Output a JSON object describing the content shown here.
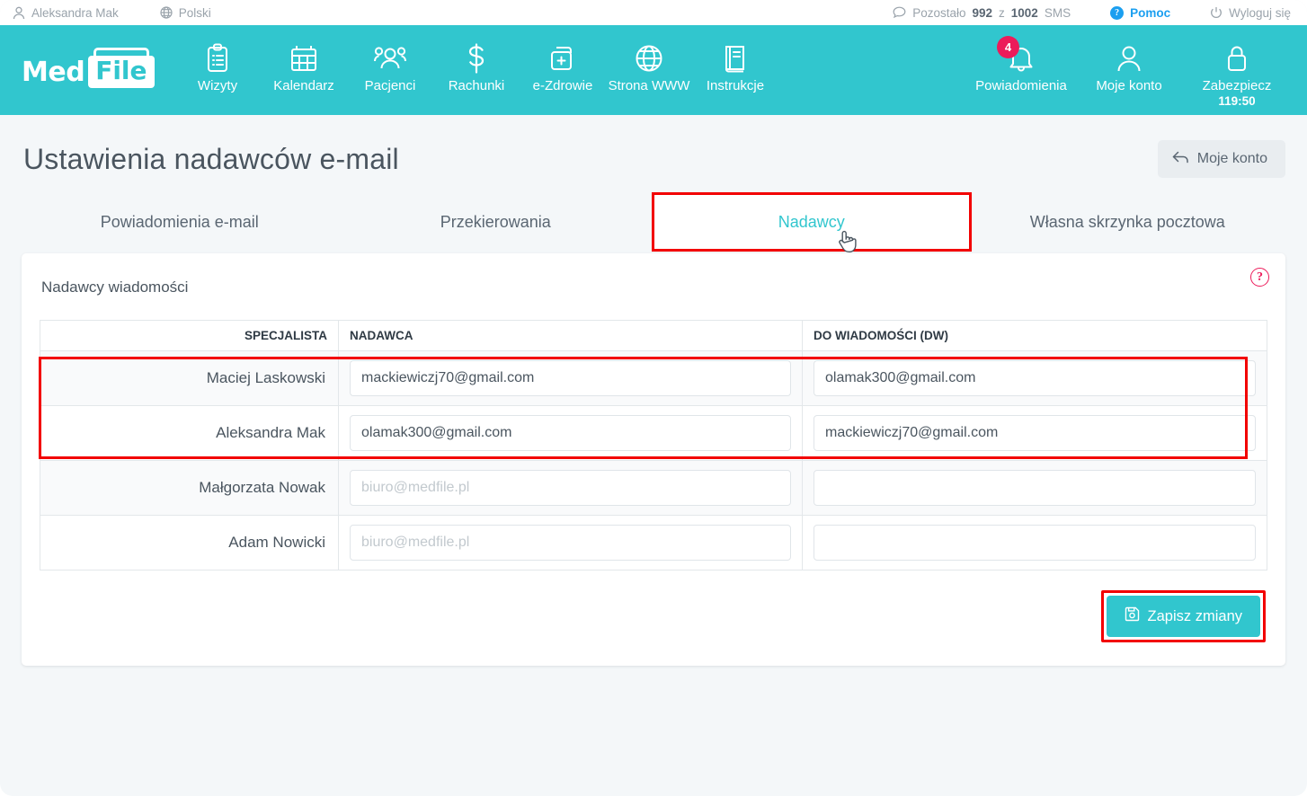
{
  "topbar": {
    "user": "Aleksandra Mak",
    "language": "Polski",
    "sms": {
      "prefix": "Pozostało",
      "remaining": "992",
      "middle": "z",
      "total": "1002",
      "suffix": "SMS"
    },
    "help": "Pomoc",
    "help_badge": "?",
    "logout": "Wyloguj się"
  },
  "brand": {
    "part1": "Med",
    "part2": "File"
  },
  "nav": {
    "items": [
      {
        "label": "Wizyty",
        "icon": "clipboard-icon"
      },
      {
        "label": "Kalendarz",
        "icon": "calendar-icon"
      },
      {
        "label": "Pacjenci",
        "icon": "people-icon"
      },
      {
        "label": "Rachunki",
        "icon": "dollar-icon"
      },
      {
        "label": "e-Zdrowie",
        "icon": "medical-file-icon"
      },
      {
        "label": "Strona WWW",
        "icon": "globe-icon"
      },
      {
        "label": "Instrukcje",
        "icon": "book-icon"
      }
    ],
    "right": [
      {
        "label": "Powiadomienia",
        "icon": "bell-icon",
        "badge": "4"
      },
      {
        "label": "Moje konto",
        "icon": "user-icon"
      },
      {
        "label": "Zabezpiecz",
        "icon": "lock-icon",
        "timer": "119:50"
      }
    ]
  },
  "page": {
    "title": "Ustawienia nadawców e-mail",
    "back_button": "Moje konto"
  },
  "tabs": [
    {
      "label": "Powiadomienia e-mail",
      "active": false
    },
    {
      "label": "Przekierowania",
      "active": false
    },
    {
      "label": "Nadawcy",
      "active": true
    },
    {
      "label": "Własna skrzynka pocztowa",
      "active": false
    }
  ],
  "card": {
    "title": "Nadawcy wiadomości",
    "help_icon": "?"
  },
  "table": {
    "headers": {
      "specialist": "SPECJALISTA",
      "sender": "NADAWCA",
      "cc": "DO WIADOMOŚCI (DW)"
    },
    "placeholder": "biuro@medfile.pl",
    "rows": [
      {
        "name": "Maciej Laskowski",
        "sender": "mackiewiczj70@gmail.com",
        "cc": "olamak300@gmail.com"
      },
      {
        "name": "Aleksandra Mak",
        "sender": "olamak300@gmail.com",
        "cc": "mackiewiczj70@gmail.com"
      },
      {
        "name": "Małgorzata Nowak",
        "sender": "",
        "cc": ""
      },
      {
        "name": "Adam Nowicki",
        "sender": "",
        "cc": ""
      }
    ]
  },
  "actions": {
    "save": "Zapisz zmiany"
  },
  "colors": {
    "accent_teal": "#31c6ce",
    "annotation_red": "#f20000",
    "badge_pink": "#ec1b5a",
    "link_blue": "#1b9ff0"
  }
}
